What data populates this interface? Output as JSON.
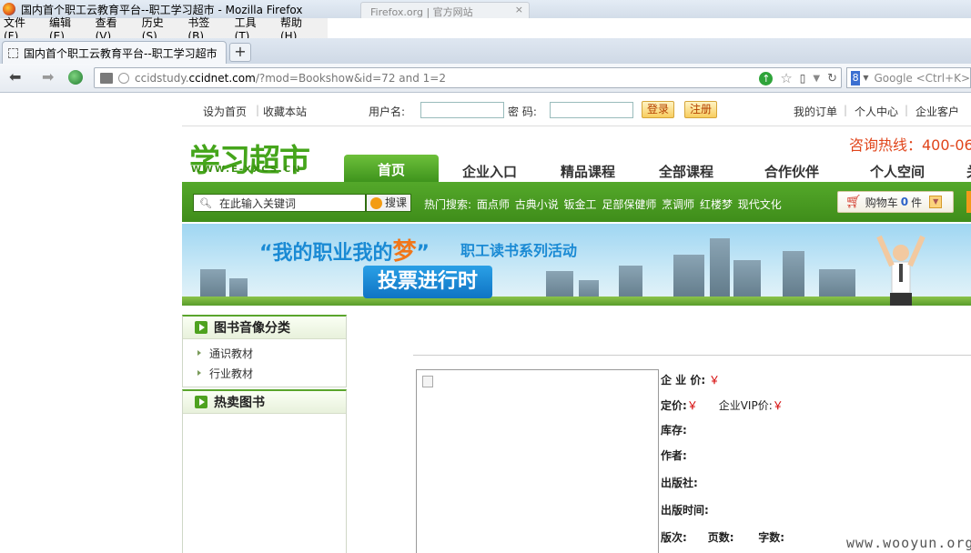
{
  "window": {
    "title": "国内首个职工云教育平台--职工学习超市 - Mozilla Firefox",
    "bg_tab_label": "Firefox.org | 官方网站"
  },
  "menu": [
    "文件(F)",
    "编辑(E)",
    "查看(V)",
    "历史(S)",
    "书签(B)",
    "工具(T)",
    "帮助(H)"
  ],
  "tab": {
    "label": "国内首个职工云教育平台--职工学习超市",
    "new_tab": "+"
  },
  "nav": {
    "url_prefix": "ccidstudy.",
    "url_domain": "ccidnet.com",
    "url_rest": "/?mod=Bookshow&id=72 and 1=2",
    "search_placeholder": "Google <Ctrl+K>",
    "search_engine_glyph": "8"
  },
  "site": {
    "top_links": {
      "home": "设为首页",
      "fav": "收藏本站",
      "orders": "我的订单",
      "center": "个人中心",
      "corp": "企业客户"
    },
    "login": {
      "user_label": "用户名:",
      "pass_label": "密 码:",
      "login_btn": "登录",
      "reg_btn": "注册"
    },
    "logo": {
      "main": "学习超市",
      "sub": "WWW.E-XXCS.CN"
    },
    "hotline": "咨询热线：400-06",
    "nav_items": [
      "首页",
      "企业入口",
      "精品课程",
      "全部课程",
      "合作伙伴",
      "个人空间",
      "关"
    ],
    "search": {
      "value": "在此输入关键词",
      "button": "搜课",
      "hot_label": "热门搜索:",
      "hot_terms": "面点师 古典小说 钣金工 足部保健师 烹调师 红楼梦 现代文化"
    },
    "cart": {
      "label": "购物车",
      "count": "0",
      "unit": "件"
    },
    "banner": {
      "title_a": "“我的职业我的",
      "title_dream": "梦",
      "title_b": "”",
      "sub": "职工读书系列活动",
      "vote": "投票进行时"
    },
    "sidebar": {
      "cat_title": "图书音像分类",
      "cat_items": [
        "通识教材",
        "行业教材"
      ],
      "hot_title": "热卖图书"
    },
    "book": {
      "corp_price": "企 业 价:",
      "list_price": "定价:",
      "vip_price": "企业VIP价:",
      "stock": "库存:",
      "author": "作者:",
      "publisher": "出版社:",
      "pub_date": "出版时间:",
      "edition": "版次:",
      "pages": "页数:",
      "words": "字数:",
      "yen": "￥"
    }
  },
  "watermark": "www.wooyun.org"
}
